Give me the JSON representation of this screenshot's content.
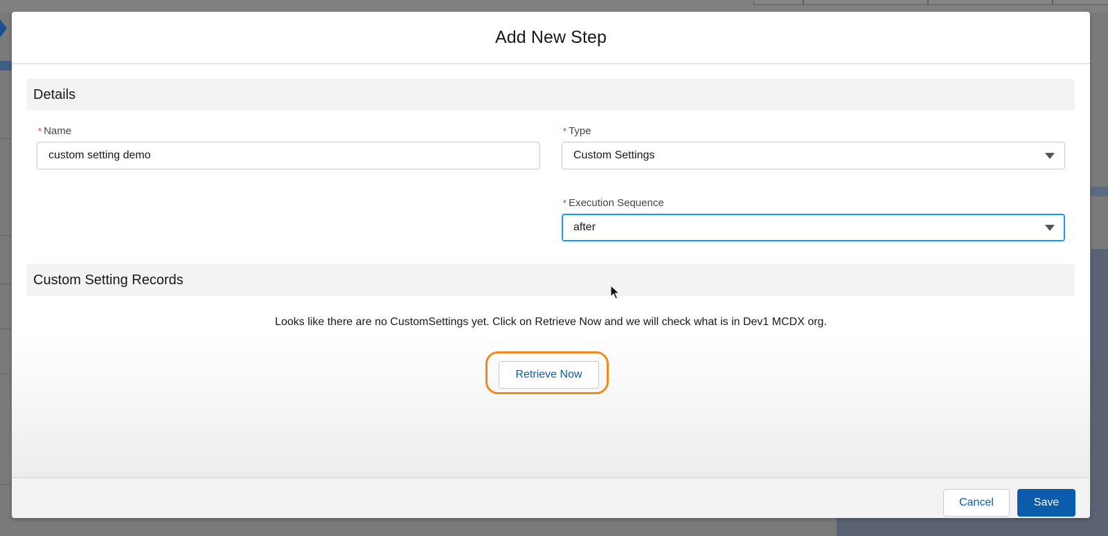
{
  "modal": {
    "title": "Add New Step"
  },
  "details_section": {
    "title": "Details",
    "name": {
      "label": "Name",
      "value": "custom setting demo"
    },
    "type": {
      "label": "Type",
      "value": "Custom Settings"
    },
    "execution_sequence": {
      "label": "Execution Sequence",
      "value": "after"
    },
    "required_marker": "*"
  },
  "records_section": {
    "title": "Custom Setting Records",
    "empty_message": "Looks like there are no CustomSettings yet. Click on Retrieve Now and we will check what is in Dev1 MCDX org.",
    "retrieve_label": "Retrieve Now"
  },
  "footer": {
    "cancel_label": "Cancel",
    "save_label": "Save"
  },
  "colors": {
    "brand_blue": "#0b5cab",
    "focus_blue": "#1b96ff",
    "required_red": "#c23934",
    "highlight_orange": "#f0891a"
  },
  "icons": {
    "select_chevron": "chevron-down-icon",
    "pointer": "mouse-pointer-icon"
  }
}
